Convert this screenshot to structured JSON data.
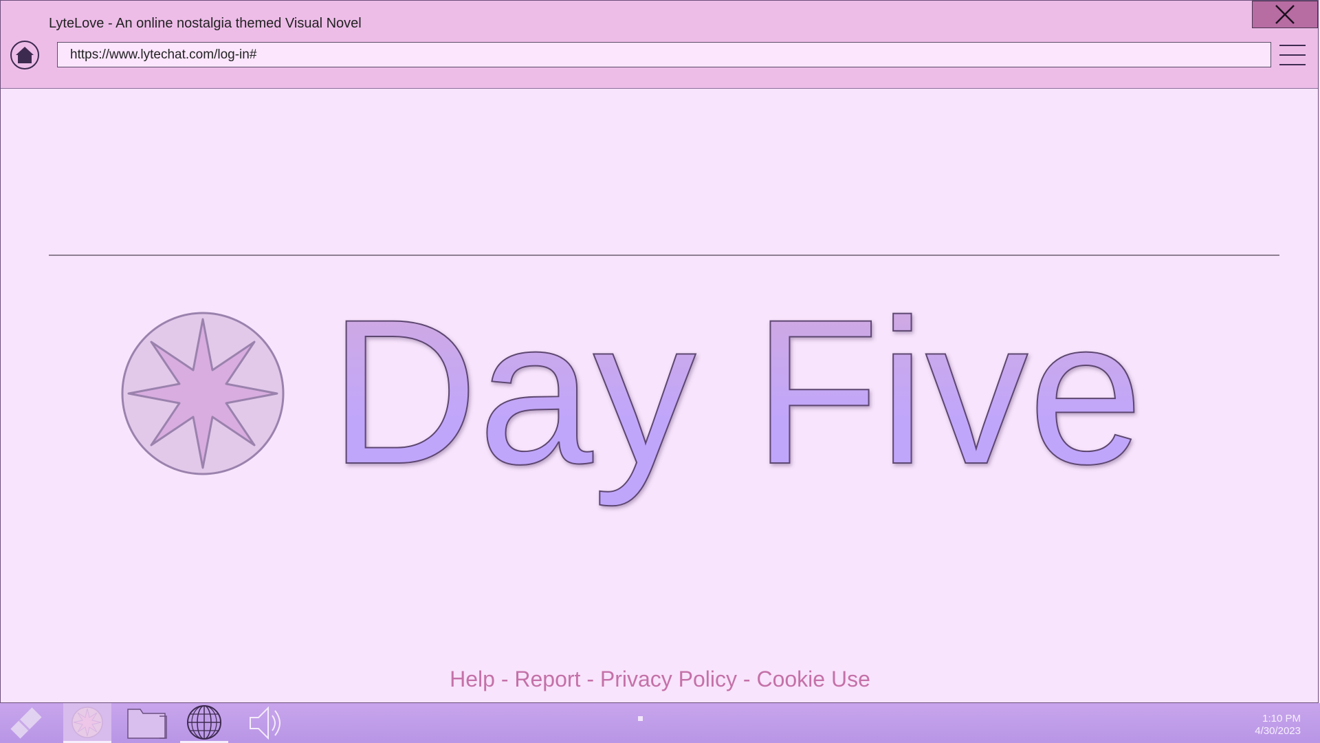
{
  "window": {
    "title": "LyteLove - An online nostalgia themed Visual Novel",
    "url": "https://www.lytechat.com/log-in#",
    "close_icon": "close-icon",
    "home_icon": "home-icon",
    "menu_icon": "hamburger-menu-icon"
  },
  "content": {
    "heading": "Day Five",
    "logo_icon": "eight-point-star-icon"
  },
  "footer": {
    "help": "Help",
    "report": "Report",
    "privacy": "Privacy Policy",
    "cookie": "Cookie Use",
    "separator": " - "
  },
  "taskbar": {
    "items": [
      {
        "name": "start-diamond-icon"
      },
      {
        "name": "lytelove-star-icon",
        "state": "active"
      },
      {
        "name": "folder-icon"
      },
      {
        "name": "globe-icon",
        "state": "open"
      },
      {
        "name": "speaker-icon"
      }
    ],
    "clock": {
      "time": "1:10 PM",
      "date": "4/30/2023"
    }
  },
  "colors": {
    "page_bg": "#f8e4fc",
    "titlebar_bg": "#edbde8",
    "close_bg": "#b76ca2",
    "taskbar_bg": "#c8a5ec",
    "heading_gradient_top": "#d4aada",
    "heading_gradient_bottom": "#c0a6fb",
    "footer_link": "#c471a8"
  }
}
